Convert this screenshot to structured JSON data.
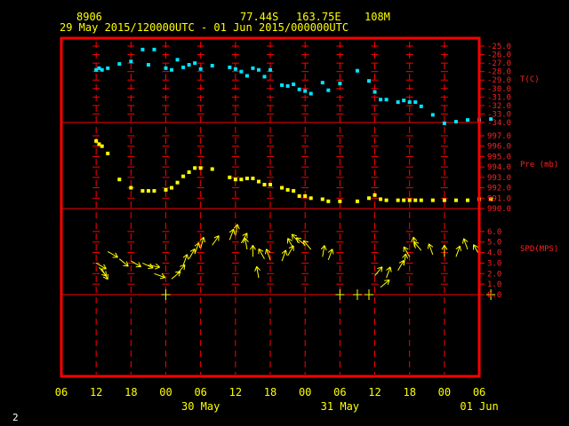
{
  "header": {
    "station": "8906",
    "lat": "77.44S",
    "lon": "163.75E",
    "elev": "108M",
    "period": "29 May 2015/120000UTC - 01 Jun 2015/000000UTC"
  },
  "footer": {
    "page": "2"
  },
  "colors": {
    "frame": "#ff0000",
    "grid": "#ff0000",
    "temp": "#00e5ff",
    "pres": "#ffff00",
    "wind": "#ffff00",
    "text": "#ffff00"
  },
  "chart_data": {
    "type": "scatter",
    "x_unit": "hours since 29 May 2015 06 UTC",
    "x_ticks": [
      "06",
      "12",
      "18",
      "00",
      "06",
      "12",
      "18",
      "00",
      "06",
      "12",
      "18",
      "00",
      "06"
    ],
    "x_date_labels": [
      "30 May",
      "31 May",
      "01 Jun"
    ],
    "panels": [
      {
        "name": "T(C)",
        "ylim": [
          -34,
          -25
        ],
        "y_ticks": [
          "-25.0",
          "-26.0",
          "-27.0",
          "-28.0",
          "-29.0",
          "-30.0",
          "-31.0",
          "-32.0",
          "-33.0",
          "-34.0"
        ],
        "x": [
          6,
          6.5,
          7,
          8,
          10,
          12,
          14,
          15,
          16,
          18,
          19,
          20,
          21,
          22,
          23,
          24,
          26,
          29,
          30,
          31,
          32,
          33,
          34,
          35,
          36,
          38,
          39,
          40,
          41,
          42,
          43,
          45,
          46,
          48,
          51,
          53,
          54,
          55,
          56,
          58,
          59,
          60,
          61,
          62,
          64,
          66,
          68,
          70,
          72,
          74
        ],
        "values": [
          -27.8,
          -27.6,
          -27.8,
          -27.6,
          -27.1,
          -26.8,
          -25.4,
          -27.2,
          -25.4,
          -27.6,
          -27.8,
          -26.6,
          -27.5,
          -27.2,
          -27.0,
          -27.7,
          -27.3,
          -27.5,
          -27.7,
          -28.0,
          -28.5,
          -27.6,
          -27.8,
          -28.6,
          -27.8,
          -29.6,
          -29.7,
          -29.5,
          -30.1,
          -30.3,
          -30.6,
          -29.3,
          -30.2,
          -29.4,
          -27.9,
          -29.1,
          -30.4,
          -31.3,
          -31.3,
          -31.6,
          -31.4,
          -31.6,
          -31.6,
          -32.1,
          -33.1,
          -34.1,
          -33.9,
          -33.7,
          -33.7,
          -33.6
        ]
      },
      {
        "name": "Pre (mb)",
        "ylim": [
          990,
          997
        ],
        "y_ticks": [
          "997.0",
          "996.0",
          "995.0",
          "994.0",
          "993.0",
          "992.0",
          "991.0",
          "990.0"
        ],
        "x": [
          6,
          6.5,
          7,
          8,
          10,
          12,
          14,
          15,
          16,
          18,
          19,
          20,
          21,
          22,
          23,
          24,
          26,
          29,
          30,
          31,
          32,
          33,
          34,
          35,
          36,
          38,
          39,
          40,
          41,
          42,
          43,
          45,
          46,
          48,
          51,
          53,
          54,
          55,
          56,
          58,
          59,
          60,
          61,
          62,
          64,
          66,
          68,
          70,
          72,
          74
        ],
        "values": [
          996.5,
          996.2,
          996.0,
          995.3,
          992.8,
          992.0,
          991.7,
          991.7,
          991.7,
          991.8,
          992.0,
          992.5,
          993.1,
          993.5,
          993.9,
          993.9,
          993.8,
          993.0,
          992.8,
          992.8,
          992.9,
          992.9,
          992.6,
          992.3,
          992.3,
          992.0,
          991.8,
          991.7,
          991.2,
          991.2,
          991.0,
          990.9,
          990.7,
          990.7,
          990.7,
          991.0,
          991.3,
          990.9,
          990.8,
          990.8,
          990.8,
          990.8,
          990.8,
          990.8,
          990.8,
          990.8,
          990.8,
          990.8,
          990.9,
          990.9
        ]
      },
      {
        "name": "SPD(MPS)",
        "ylim": [
          0,
          7
        ],
        "y_ticks": [
          "6.0",
          "5.0",
          "4.0",
          "3.0",
          "2.0",
          "1.0",
          "0.0"
        ],
        "x": [
          6,
          6.5,
          7,
          8,
          10,
          12,
          14,
          15,
          16,
          18,
          19,
          20,
          21,
          22,
          23,
          24,
          26,
          29,
          30,
          31,
          32,
          33,
          34,
          35,
          36,
          38,
          39,
          40,
          41,
          42,
          43,
          45,
          46,
          48,
          51,
          53,
          54,
          55,
          56,
          58,
          59,
          60,
          61,
          62,
          64,
          66,
          68,
          70,
          72,
          74
        ],
        "values": [
          3.0,
          2.6,
          2.4,
          4.1,
          3.4,
          3.2,
          3.0,
          2.8,
          2.0,
          0.0,
          1.5,
          2.0,
          2.8,
          3.4,
          3.9,
          4.4,
          4.7,
          5.2,
          5.6,
          4.9,
          4.3,
          3.6,
          1.6,
          3.4,
          3.3,
          3.2,
          3.7,
          4.4,
          4.9,
          4.7,
          4.3,
          3.6,
          3.3,
          0.0,
          0.0,
          0.0,
          1.8,
          0.7,
          1.6,
          2.3,
          2.8,
          3.6,
          4.4,
          4.2,
          3.8,
          3.6,
          3.6,
          4.3,
          3.8,
          0.0
        ],
        "direction_deg": [
          300,
          320,
          330,
          300,
          310,
          300,
          295,
          280,
          290,
          0,
          230,
          220,
          200,
          210,
          200,
          195,
          215,
          200,
          190,
          210,
          170,
          180,
          170,
          150,
          160,
          200,
          210,
          150,
          140,
          130,
          140,
          190,
          200,
          0,
          0,
          0,
          220,
          230,
          200,
          210,
          190,
          150,
          170,
          140,
          160,
          180,
          200,
          160,
          150,
          0
        ]
      }
    ]
  }
}
